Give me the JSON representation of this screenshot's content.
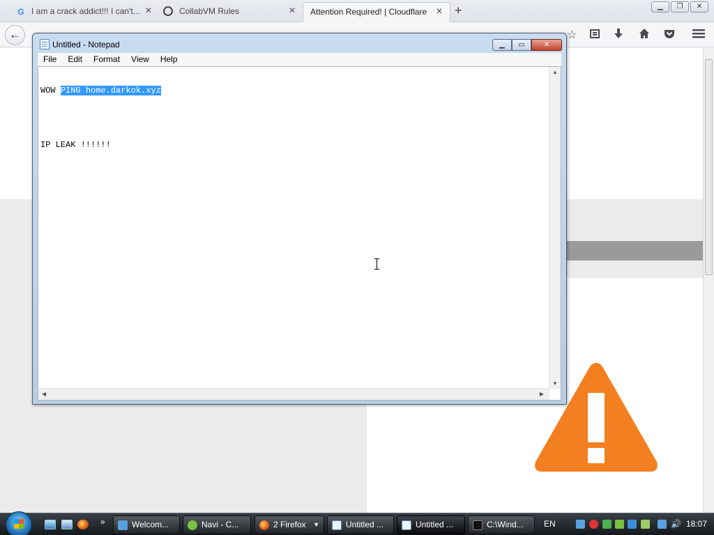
{
  "browser": {
    "tabs": [
      {
        "label": "I am a crack addict!!! I can't...",
        "favicon": "google-icon",
        "active": false
      },
      {
        "label": "CollabVM Rules",
        "favicon": "collabvm-icon",
        "active": false
      },
      {
        "label": "Attention Required! | Cloudflare",
        "favicon": "",
        "active": true
      }
    ],
    "new_tab_symbol": "+",
    "close_symbol": "✕",
    "window_buttons": [
      "▁",
      "❐",
      "✕"
    ]
  },
  "navbar": {
    "back_icon": "back-arrow-icon",
    "right_icons": [
      "star-icon",
      "reading-list-icon",
      "download-icon",
      "home-icon",
      "pocket-icon",
      "menu-icon"
    ]
  },
  "notepad": {
    "title": "Untitled - Notepad",
    "menu": [
      "File",
      "Edit",
      "Format",
      "View",
      "Help"
    ],
    "content": {
      "line1_plain": "WOW ",
      "line1_selected": "PING home.darkok.xyz",
      "line2": "",
      "line3": "IP LEAK !!!!!!"
    },
    "controls": [
      "▁",
      "▭",
      "✕"
    ]
  },
  "page": {
    "warning_icon": "warning-triangle-icon",
    "colors": {
      "warning": "#f38020",
      "grey_band": "#ebebeb",
      "dark_bar": "#9a9a9a"
    }
  },
  "taskbar": {
    "start": "windows-orb-icon",
    "quick_launch": [
      "show-desktop-icon",
      "switch-windows-icon",
      "firefox-icon"
    ],
    "overflow": "»",
    "items": [
      {
        "label": "Welcom...",
        "icon": "document-icon",
        "active": false
      },
      {
        "label": "Navi - C...",
        "icon": "navi-icon",
        "active": false
      },
      {
        "label": "2 Firefox",
        "icon": "firefox-icon",
        "active": false
      },
      {
        "label": "Untitled ...",
        "icon": "notepad-icon",
        "active": false
      },
      {
        "label": "Untitled ...",
        "icon": "notepad-icon",
        "active": true
      },
      {
        "label": "C:\\Wind...",
        "icon": "cmd-icon",
        "active": false
      }
    ],
    "language": "EN",
    "clock": "18:07"
  }
}
